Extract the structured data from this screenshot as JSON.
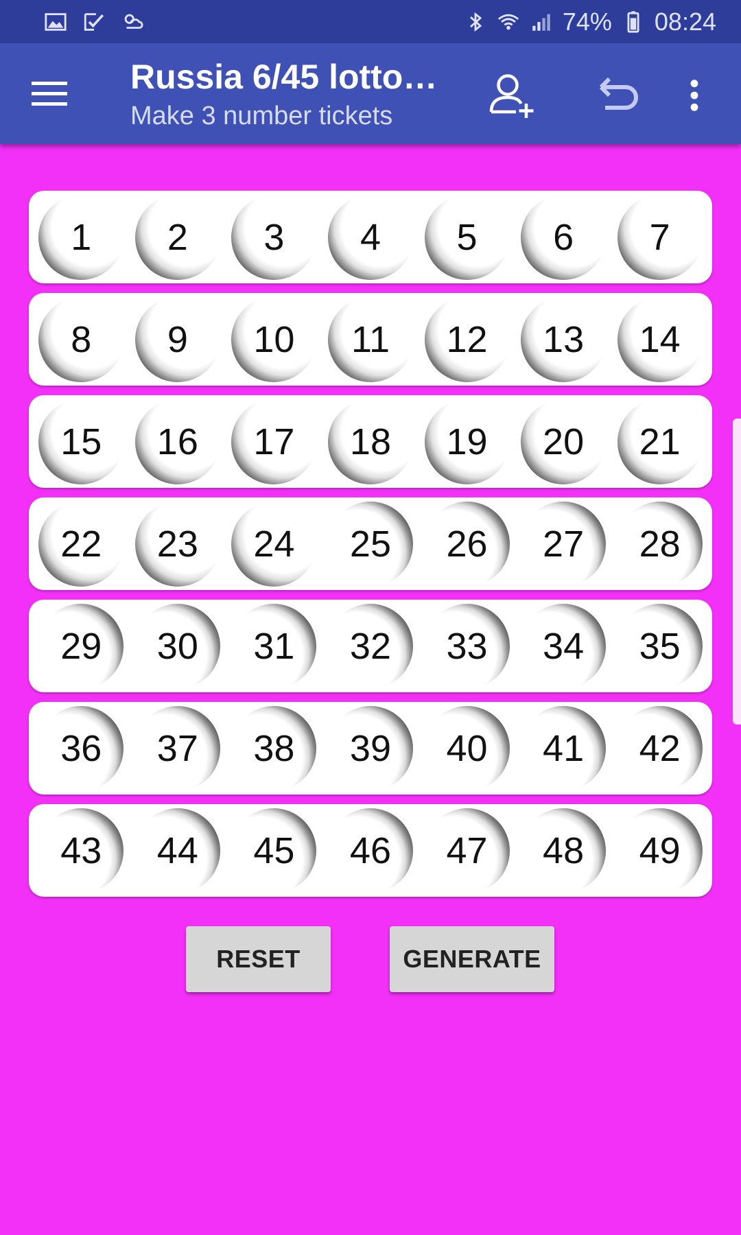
{
  "status_bar": {
    "left_icons": [
      "image-icon",
      "check-list-icon",
      "weather-icon"
    ],
    "battery": "74%",
    "time": "08:24"
  },
  "app_bar": {
    "title": "Russia 6/45 lotto…",
    "subtitle": "Make 3 number tickets",
    "icons": [
      "menu-icon",
      "add-person-icon",
      "undo-icon",
      "more-vert-icon"
    ]
  },
  "grid": {
    "rows": [
      [
        1,
        2,
        3,
        4,
        5,
        6,
        7
      ],
      [
        8,
        9,
        10,
        11,
        12,
        13,
        14
      ],
      [
        15,
        16,
        17,
        18,
        19,
        20,
        21
      ],
      [
        22,
        23,
        24,
        25,
        26,
        27,
        28
      ],
      [
        29,
        30,
        31,
        32,
        33,
        34,
        35
      ],
      [
        36,
        37,
        38,
        39,
        40,
        41,
        42
      ],
      [
        43,
        44,
        45,
        46,
        47,
        48,
        49
      ]
    ],
    "shade_left_max": 24
  },
  "buttons": {
    "reset_label": "RESET",
    "generate_label": "GENERATE"
  },
  "colors": {
    "background": "#f230f7",
    "app_bar": "#3f51b5",
    "status_bar": "#2f3d9a"
  }
}
